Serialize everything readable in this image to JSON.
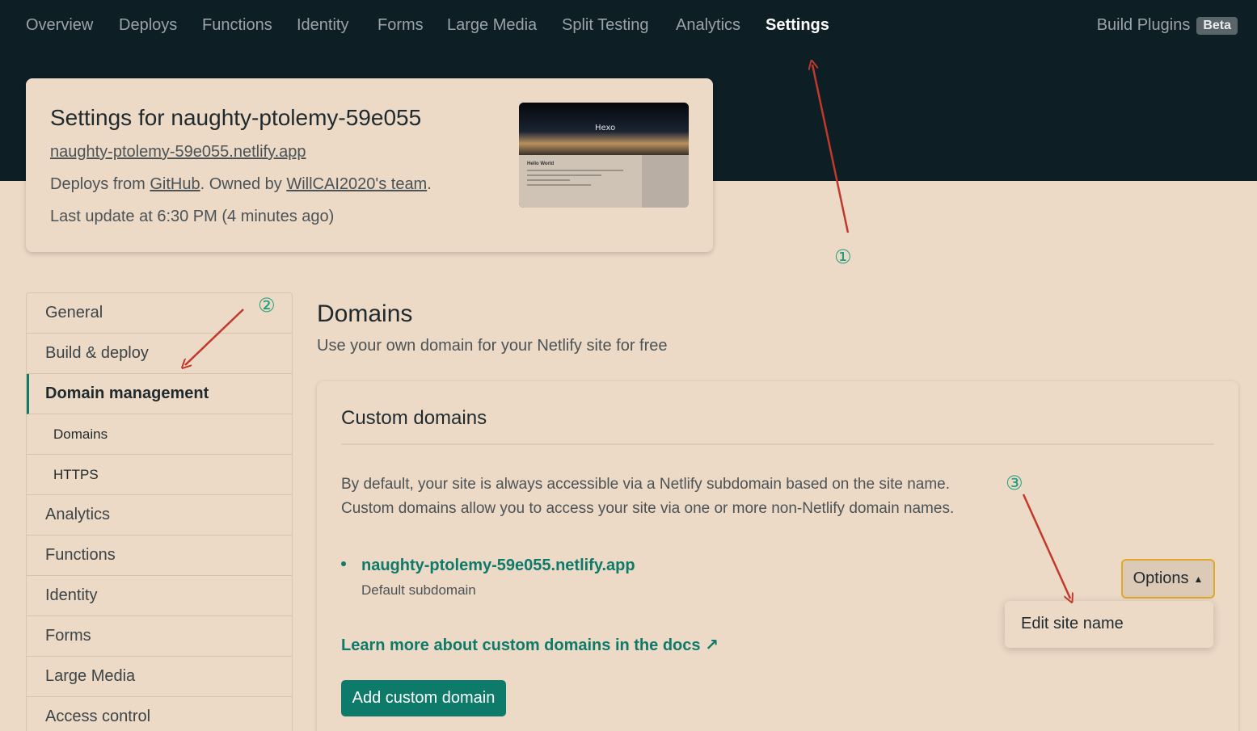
{
  "nav": {
    "items": [
      "Overview",
      "Deploys",
      "Functions",
      "Identity",
      "Forms",
      "Large Media",
      "Split Testing",
      "Analytics",
      "Settings"
    ],
    "active": "Settings",
    "right_label": "Build Plugins",
    "right_badge": "Beta"
  },
  "site": {
    "title": "Settings for naughty-ptolemy-59e055",
    "url": "naughty-ptolemy-59e055.netlify.app",
    "deploys_prefix": "Deploys from ",
    "deploys_source": "GitHub",
    "owned_prefix": ". Owned by ",
    "owner": "WillCAI2020's team",
    "owned_suffix": ".",
    "last_update": "Last update at 6:30 PM (4 minutes ago)",
    "preview": {
      "hero_text": "Hexo",
      "post_title": "Hello World"
    }
  },
  "sidebar": {
    "items": [
      {
        "label": "General"
      },
      {
        "label": "Build & deploy"
      },
      {
        "label": "Domain management",
        "active": true
      },
      {
        "label": "Domains",
        "sub": true
      },
      {
        "label": "HTTPS",
        "sub": true
      },
      {
        "label": "Analytics"
      },
      {
        "label": "Functions"
      },
      {
        "label": "Identity"
      },
      {
        "label": "Forms"
      },
      {
        "label": "Large Media"
      },
      {
        "label": "Access control"
      }
    ]
  },
  "main": {
    "title": "Domains",
    "description": "Use your own domain for your Netlify site for free",
    "panel": {
      "title": "Custom domains",
      "para_line1": "By default, your site is always accessible via a Netlify subdomain based on the site name.",
      "para_line2": "Custom domains allow you to access your site via one or more non-Netlify domain names.",
      "domain": "naughty-ptolemy-59e055.netlify.app",
      "domain_sub": "Default subdomain",
      "learn_link": "Learn more about custom domains in the docs ↗",
      "add_button": "Add custom domain",
      "options_button": "Options",
      "dropdown_item": "Edit site name"
    }
  },
  "annotations": {
    "markers": [
      "①",
      "②",
      "③"
    ],
    "arrow_color": "#c0392b",
    "marker_color": "#1e9d7f"
  },
  "colors": {
    "nav_bg": "#0e1e25",
    "page_bg": "#ecd9c6",
    "accent": "#0e7a6a",
    "focus": "#e0a92a"
  }
}
